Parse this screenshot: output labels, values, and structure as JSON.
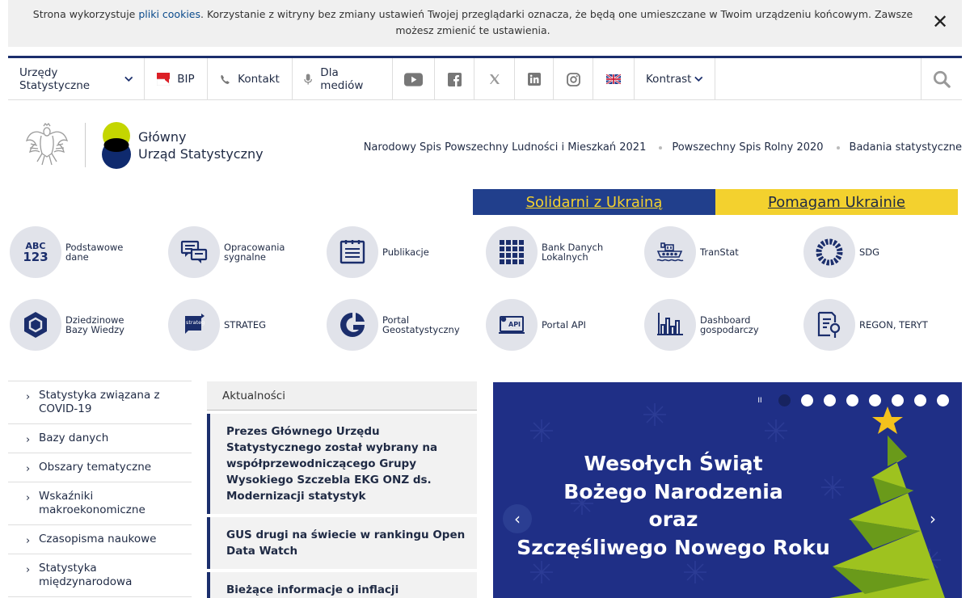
{
  "cookie": {
    "text_before": "Strona wykorzystuje ",
    "link": "pliki cookies",
    "text_after": ". Korzystanie z witryny bez zmiany ustawień Twojej przeglądarki oznacza, że będą one umieszczane w Twoim urządzeniu końcowym. Zawsze możesz zmienić te ustawienia.",
    "close": "✕"
  },
  "nav": {
    "offices": "Urzędy Statystyczne",
    "bip": "BIP",
    "contact": "Kontakt",
    "media": "Dla mediów",
    "contrast": "Kontrast"
  },
  "header": {
    "logo_line1": "Główny",
    "logo_line2": "Urząd Statystyczny",
    "links": [
      "Narodowy Spis Powszechny Ludności i Mieszkań 2021",
      "Powszechny Spis Rolny 2020",
      "Badania statystyczne"
    ]
  },
  "ukraine": {
    "left": "Solidarni z Ukrainą",
    "right": "Pomagam Ukrainie"
  },
  "tiles": [
    {
      "label1": "Podstawowe",
      "label2": "dane",
      "icon": "abc123-icon",
      "abc": "ABC",
      "num": "123"
    },
    {
      "label1": "Opracowania",
      "label2": "sygnalne",
      "icon": "chat-icon"
    },
    {
      "label1": "Publikacje",
      "label2": "",
      "icon": "document-icon"
    },
    {
      "label1": "Bank Danych",
      "label2": "Lokalnych",
      "icon": "grid-icon"
    },
    {
      "label1": "TranStat",
      "label2": "",
      "icon": "ship-icon"
    },
    {
      "label1": "SDG",
      "label2": "",
      "icon": "sdg-wheel-icon"
    },
    {
      "label1": "Dziedzinowe",
      "label2": "Bazy Wiedzy",
      "icon": "hexagon-icon"
    },
    {
      "label1": "STRATEG",
      "label2": "",
      "icon": "strateg-icon",
      "badge": "strateg"
    },
    {
      "label1": "Portal",
      "label2": "Geostatystyczny",
      "icon": "geo-icon"
    },
    {
      "label1": "Portal API",
      "label2": "",
      "icon": "api-icon",
      "badge": "API"
    },
    {
      "label1": "Dashboard",
      "label2": "gospodarczy",
      "icon": "dashboard-icon"
    },
    {
      "label1": "REGON, TERYT",
      "label2": "",
      "icon": "regon-search-icon"
    }
  ],
  "sidebar": {
    "chevron": "›",
    "items": [
      "Statystyka związana z COVID-19",
      "Bazy danych",
      "Obszary tematyczne",
      "Wskaźniki makroekonomiczne",
      "Czasopisma naukowe",
      "Statystyka międzynarodowa"
    ]
  },
  "news": {
    "title": "Aktualności",
    "items": [
      "Prezes Głównego Urzędu Statystycznego został wybrany na współprzewodniczącego Grupy Wysokiego Szczebla EKG ONZ ds. Modernizacji statystyk",
      "GUS drugi na świecie w rankingu Open Data Watch",
      "Bieżące informacje o inflacji"
    ]
  },
  "slider": {
    "line1": "Wesołych Świąt",
    "line2": "Bożego Narodzenia",
    "line3": "oraz",
    "line4": "Szczęśliwego Nowego Roku",
    "pause": "II",
    "prev": "‹",
    "next": "›"
  },
  "colors": {
    "navy": "#1b2e6c",
    "ukraine_blue": "#213f8c",
    "ukraine_yellow": "#f3d12e",
    "logo_green": "#c4d600",
    "slider_bg": "#1f2f86"
  }
}
